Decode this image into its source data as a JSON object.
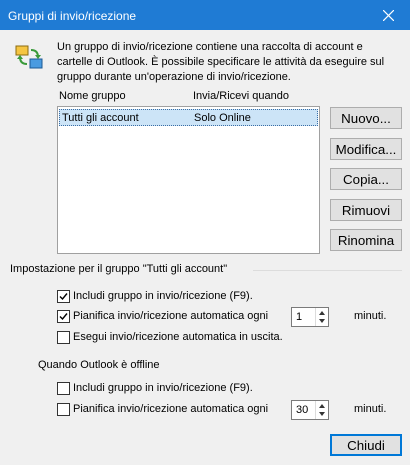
{
  "window": {
    "title": "Gruppi di invio/ricezione"
  },
  "intro_text": "Un gruppo di invio/ricezione contiene una raccolta di account e cartelle di Outlook. È possibile specificare le attività da eseguire sul gruppo durante un'operazione di invio/ricezione.",
  "groups_list": {
    "columns": [
      "Nome gruppo",
      "Invia/Ricevi quando"
    ],
    "rows": [
      {
        "name": "Tutti gli account",
        "when": "Solo Online"
      }
    ]
  },
  "buttons": {
    "new": "Nuovo...",
    "edit": "Modifica...",
    "copy": "Copia...",
    "remove": "Rimuovi",
    "rename": "Rinomina",
    "close": "Chiudi"
  },
  "online_settings": {
    "heading": "Impostazione per il gruppo \"Tutti gli account\"",
    "include_label": "Includi gruppo in invio/ricezione (F9).",
    "include_checked": true,
    "schedule_label": "Pianifica invio/ricezione automatica ogni",
    "schedule_checked": true,
    "schedule_value": "1",
    "schedule_unit": "minuti.",
    "on_exit_label": "Esegui invio/ricezione automatica in uscita.",
    "on_exit_checked": false
  },
  "offline_settings": {
    "heading": "Quando Outlook è offline",
    "include_label": "Includi gruppo in invio/ricezione (F9).",
    "include_checked": false,
    "schedule_label": "Pianifica invio/ricezione automatica ogni",
    "schedule_checked": false,
    "schedule_value": "30",
    "schedule_unit": "minuti."
  },
  "icons": {
    "close": "close-icon",
    "sync": "send-receive-sync-icon",
    "check": "checkmark-icon",
    "spin_up": "chevron-up-icon",
    "spin_down": "chevron-down-icon"
  },
  "colors": {
    "titlebar": "#1f7bd4",
    "selection": "#cce4f7",
    "default_button_border": "#0078d7"
  }
}
